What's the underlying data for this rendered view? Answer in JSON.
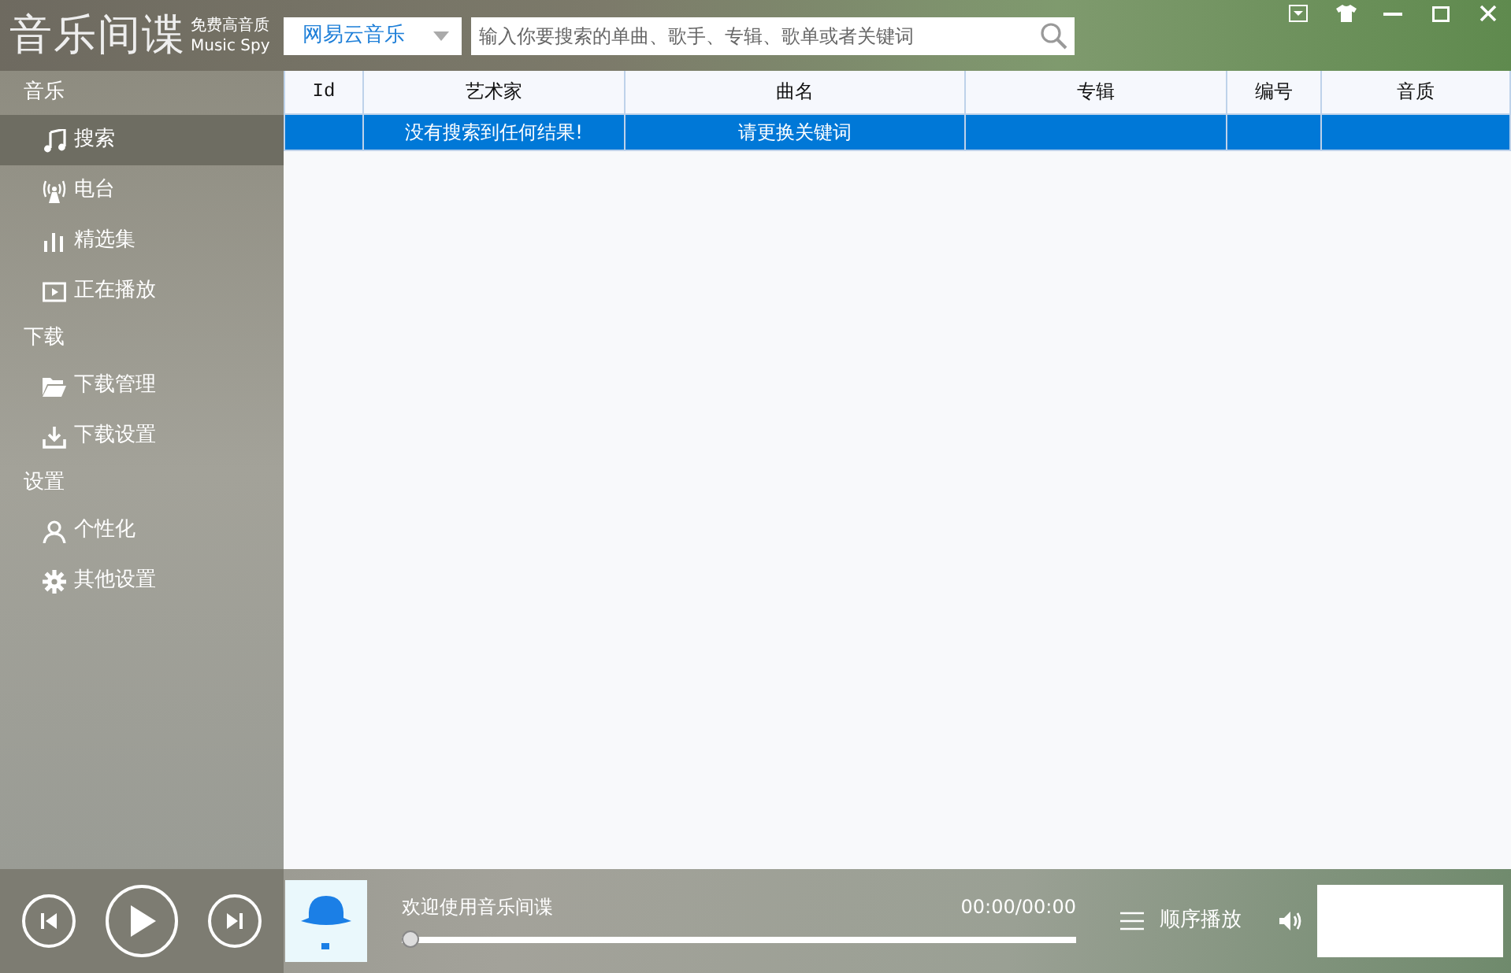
{
  "app": {
    "title": "音乐间谍",
    "tagline": "免费高音质",
    "tagline_en": "Music Spy"
  },
  "source_select": {
    "value": "网易云音乐"
  },
  "search": {
    "placeholder": "输入你要搜索的单曲、歌手、专辑、歌单或者关键词"
  },
  "sidebar": {
    "sections": [
      {
        "label": "音乐",
        "items": [
          {
            "label": "搜索",
            "selected": true
          },
          {
            "label": "电台",
            "selected": false
          },
          {
            "label": "精选集",
            "selected": false
          },
          {
            "label": "正在播放",
            "selected": false
          }
        ]
      },
      {
        "label": "下载",
        "items": [
          {
            "label": "下载管理",
            "selected": false
          },
          {
            "label": "下载设置",
            "selected": false
          }
        ]
      },
      {
        "label": "设置",
        "items": [
          {
            "label": "个性化",
            "selected": false
          },
          {
            "label": "其他设置",
            "selected": false
          }
        ]
      }
    ]
  },
  "table": {
    "columns": [
      "Id",
      "艺术家",
      "曲名",
      "专辑",
      "编号",
      "音质"
    ],
    "rows": [
      {
        "selected": true,
        "artist": "没有搜索到任何结果!",
        "title": "请更换关键词"
      }
    ]
  },
  "player": {
    "track": "欢迎使用音乐间谍",
    "time": "00:00/00:00",
    "progress": {
      "level": 0
    },
    "play_mode": "顺序播放"
  }
}
